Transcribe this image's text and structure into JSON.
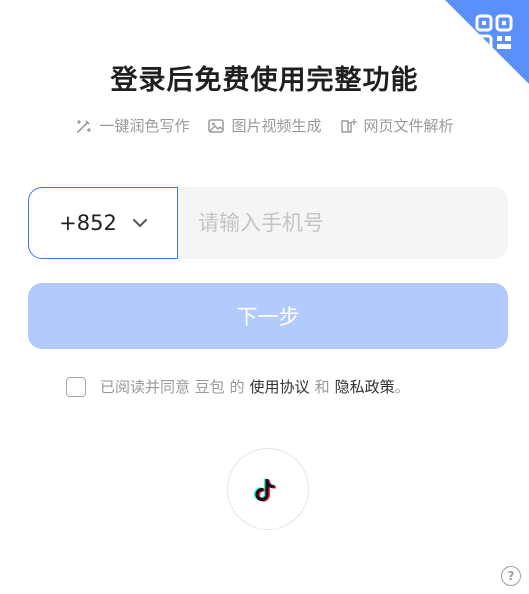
{
  "header": {
    "title": "登录后免费使用完整功能",
    "qr_icon": "qr-code-icon"
  },
  "features": [
    {
      "icon": "magic-pen-icon",
      "label": "一键润色写作"
    },
    {
      "icon": "image-icon",
      "label": "图片视频生成"
    },
    {
      "icon": "book-sparkle-icon",
      "label": "网页文件解析"
    }
  ],
  "phone": {
    "country_code": "+852",
    "placeholder": "请输入手机号",
    "value": ""
  },
  "next_button": {
    "label": "下一步"
  },
  "agreement": {
    "prefix": "已阅读并同意 豆包 的",
    "terms_link": "使用协议",
    "and": "和",
    "privacy_link": "隐私政策",
    "suffix": "。"
  },
  "social": {
    "tiktok_icon": "tiktok-icon"
  },
  "help": {
    "icon": "help-icon",
    "label": "?"
  },
  "colors": {
    "accent": "#5b8ff9",
    "button_disabled": "#b3cbfc",
    "input_bg": "#f5f5f5",
    "select_border": "#3b78e7"
  }
}
